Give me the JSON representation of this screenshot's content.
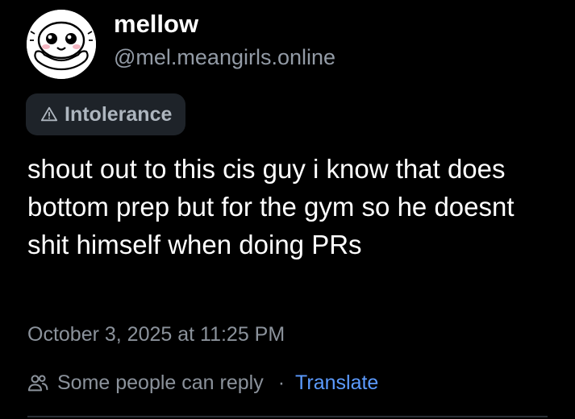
{
  "author": {
    "display_name": "mellow",
    "handle": "@mel.meangirls.online",
    "avatar_icon": "cartoon-face-avatar"
  },
  "label": {
    "icon": "warning-triangle-icon",
    "text": "Intolerance"
  },
  "post": {
    "text": "shout out to this cis guy i know that does bottom prep but for the gym so he doesnt shit himself when doing PRs"
  },
  "timestamp": "October 3, 2025 at 11:25 PM",
  "meta": {
    "reply_icon": "people-icon",
    "reply_setting": "Some people can reply",
    "separator": "·",
    "translate_label": "Translate"
  },
  "colors": {
    "background": "#000000",
    "text_primary": "#ffffff",
    "text_secondary": "#8b929b",
    "chip_background": "#1e2329",
    "link": "#5c9bff"
  }
}
